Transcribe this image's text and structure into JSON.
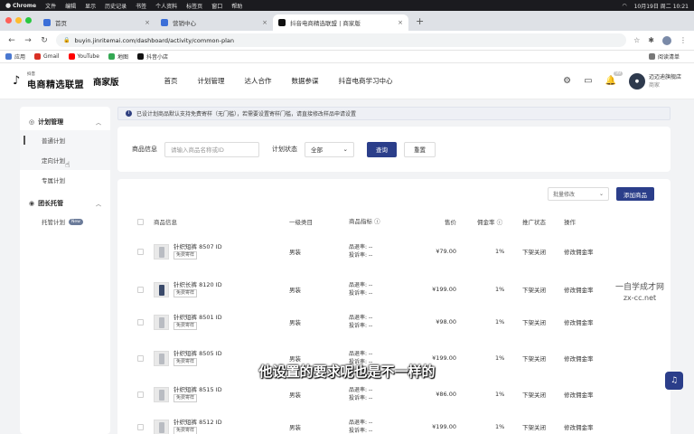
{
  "menubar": {
    "items": [
      "Chrome",
      "文件",
      "编辑",
      "显示",
      "历史记录",
      "书签",
      "个人资料",
      "标签页",
      "窗口",
      "帮助"
    ],
    "clock": "10月19日 周二 10:21"
  },
  "tabs": [
    {
      "label": "首页"
    },
    {
      "label": "营销中心"
    },
    {
      "label": "抖音电商精选联盟 | 商家版"
    }
  ],
  "address": {
    "url": "buyin.jinritemai.com/dashboard/activity/common-plan"
  },
  "bookmarks": {
    "items": [
      "应用",
      "Gmail",
      "YouTube",
      "地图",
      "抖音小店"
    ],
    "reading_list": "阅读清单"
  },
  "app": {
    "brand_small": "抖音",
    "brand": "电商精选联盟",
    "edition": "商家版",
    "nav": [
      "首页",
      "计划管理",
      "达人合作",
      "数据参谋",
      "抖音电商学习中心"
    ],
    "notification_badge": "99",
    "user": {
      "name": "迈迈迪旗舰店",
      "role": "商家"
    }
  },
  "sidebar": {
    "groups": [
      {
        "title": "计划管理",
        "items": [
          {
            "label": "普通计划"
          },
          {
            "label": "定向计划"
          },
          {
            "label": "专属计划"
          }
        ]
      },
      {
        "title": "团长托管",
        "items": [
          {
            "label": "托管计划",
            "tag": "New"
          }
        ]
      }
    ]
  },
  "notice": {
    "text": "已设计划商品默认支持免费寄样（无门槛），若需要设置寄样门槛，请直接修改样品申请设置"
  },
  "filter": {
    "product_label": "商品信息",
    "product_placeholder": "请输入商品名称或ID",
    "status_label": "计划状态",
    "status_value": "全部",
    "search_label": "查询",
    "reset_label": "重置"
  },
  "table": {
    "bulk_label": "批量修改",
    "add_label": "添加商品",
    "headers": {
      "product": "商品信息",
      "category": "一级类目",
      "metrics": "商品指标",
      "price": "售价",
      "commission": "佣金率",
      "status": "推广状态",
      "actions": "操作"
    },
    "rows": [
      {
        "name": "针织短裤 8507 ID",
        "tag": "免费寄样",
        "category": "男装",
        "metric1": "品退率: --",
        "metric2": "投诉率: --",
        "price": "¥79.00",
        "commission": "1%",
        "status": "下架关闭",
        "action": "修改佣金率"
      },
      {
        "name": "针织长裤 8120 ID",
        "tag": "免费寄样",
        "category": "男装",
        "metric1": "品退率: --",
        "metric2": "投诉率: --",
        "price": "¥199.00",
        "commission": "1%",
        "status": "下架关闭",
        "action": "修改佣金率"
      },
      {
        "name": "针织短裤 8501 ID",
        "tag": "免费寄样",
        "category": "男装",
        "metric1": "品退率: --",
        "metric2": "投诉率: --",
        "price": "¥98.00",
        "commission": "1%",
        "status": "下架关闭",
        "action": "修改佣金率"
      },
      {
        "name": "针织短裤 8505 ID",
        "tag": "免费寄样",
        "category": "男装",
        "metric1": "品退率: --",
        "metric2": "投诉率: --",
        "price": "¥199.00",
        "commission": "1%",
        "status": "下架关闭",
        "action": "修改佣金率"
      },
      {
        "name": "针织短裤 8515 ID",
        "tag": "免费寄样",
        "category": "男装",
        "metric1": "品退率: --",
        "metric2": "投诉率: --",
        "price": "¥86.00",
        "commission": "1%",
        "status": "下架关闭",
        "action": "修改佣金率"
      },
      {
        "name": "针织短裤 8512 ID",
        "tag": "免费寄样",
        "category": "男装",
        "metric1": "品退率: --",
        "metric2": "投诉率: --",
        "price": "¥199.00",
        "commission": "1%",
        "status": "下架关闭",
        "action": "修改佣金率"
      }
    ]
  },
  "overlay": {
    "subtitle": "他设置的要求呢也是不一样的",
    "watermark_line1": "一自学成才网",
    "watermark_line2": "zx-cc.net"
  },
  "colors": {
    "primary": "#2b3e8a",
    "page_bg": "#f2f3f5"
  }
}
